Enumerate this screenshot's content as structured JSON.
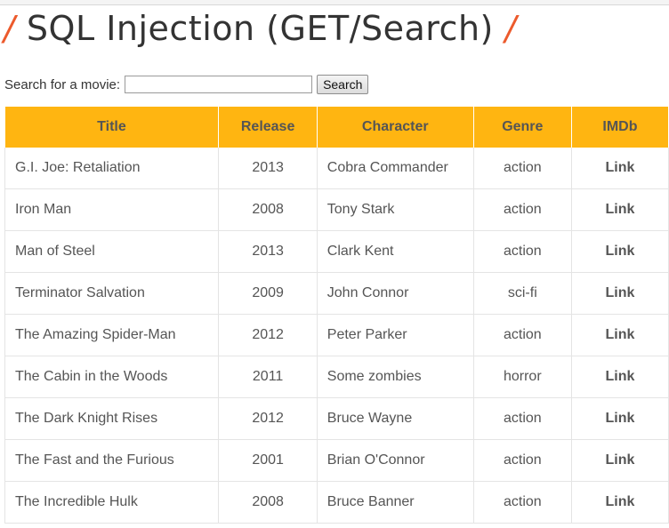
{
  "header": {
    "title": "SQL Injection (GET/Search)",
    "slash_left": "/",
    "slash_right": "/"
  },
  "search": {
    "label": "Search for a movie:",
    "value": "",
    "placeholder": "",
    "button_label": "Search"
  },
  "table": {
    "columns": [
      "Title",
      "Release",
      "Character",
      "Genre",
      "IMDb"
    ],
    "rows": [
      {
        "title": "G.I. Joe: Retaliation",
        "release": "2013",
        "character": "Cobra Commander",
        "genre": "action",
        "imdb": "Link"
      },
      {
        "title": "Iron Man",
        "release": "2008",
        "character": "Tony Stark",
        "genre": "action",
        "imdb": "Link"
      },
      {
        "title": "Man of Steel",
        "release": "2013",
        "character": "Clark Kent",
        "genre": "action",
        "imdb": "Link"
      },
      {
        "title": "Terminator Salvation",
        "release": "2009",
        "character": "John Connor",
        "genre": "sci-fi",
        "imdb": "Link"
      },
      {
        "title": "The Amazing Spider-Man",
        "release": "2012",
        "character": "Peter Parker",
        "genre": "action",
        "imdb": "Link"
      },
      {
        "title": "The Cabin in the Woods",
        "release": "2011",
        "character": "Some zombies",
        "genre": "horror",
        "imdb": "Link"
      },
      {
        "title": "The Dark Knight Rises",
        "release": "2012",
        "character": "Bruce Wayne",
        "genre": "action",
        "imdb": "Link"
      },
      {
        "title": "The Fast and the Furious",
        "release": "2001",
        "character": "Brian O'Connor",
        "genre": "action",
        "imdb": "Link"
      },
      {
        "title": "The Incredible Hulk",
        "release": "2008",
        "character": "Bruce Banner",
        "genre": "action",
        "imdb": "Link"
      }
    ]
  },
  "colors": {
    "header_background": "#ffb511",
    "title_slash": "#ec5a2c",
    "text": "#555555"
  }
}
